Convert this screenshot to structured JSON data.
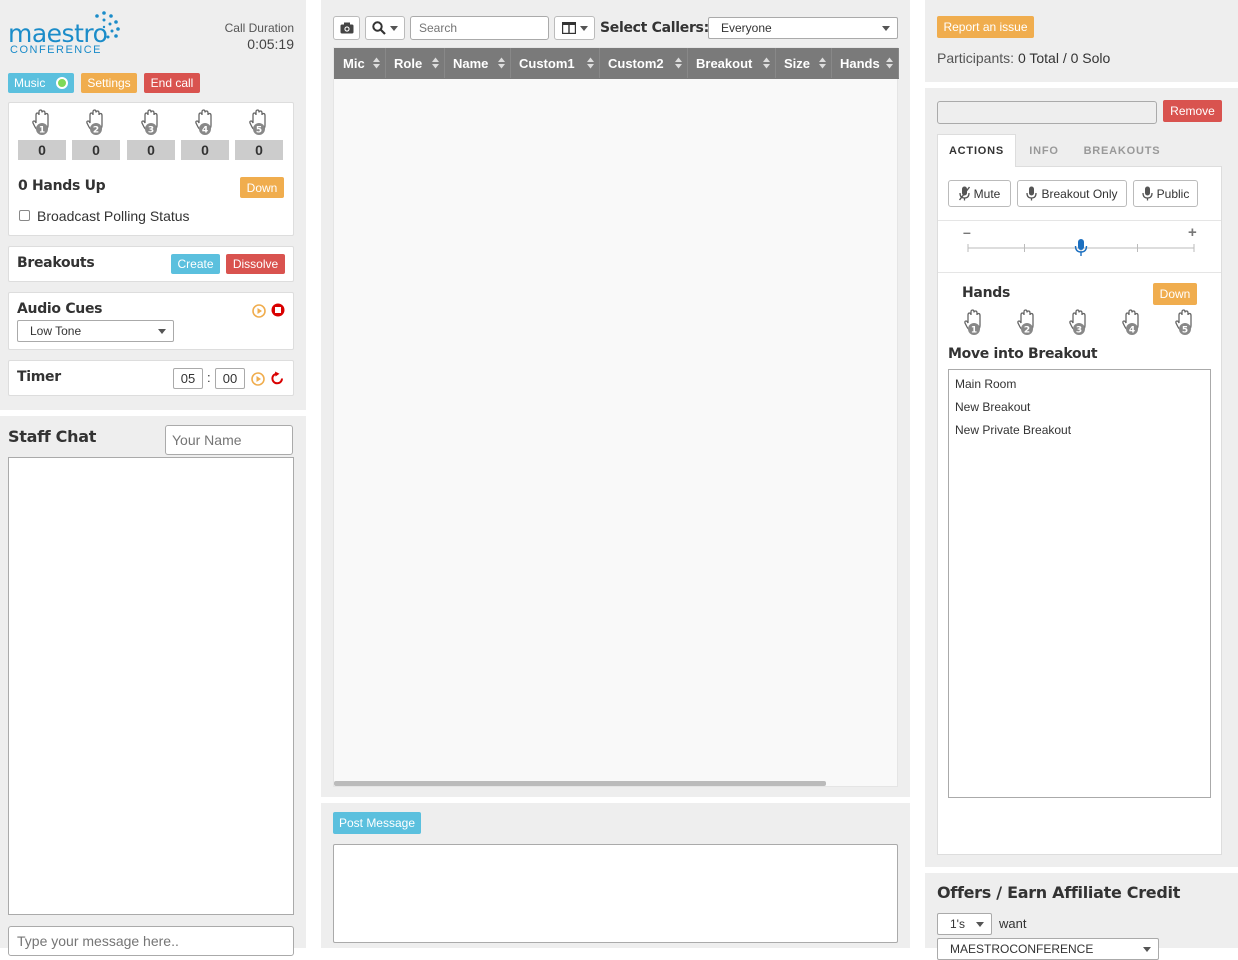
{
  "logo": {
    "word1": "maestro",
    "word2": "CONFERENCE"
  },
  "call": {
    "label": "Call Duration",
    "value": "0:05:19"
  },
  "controls": {
    "music": "Music",
    "settings": "Settings",
    "end_call": "End call"
  },
  "hands_panel": {
    "counts": [
      "0",
      "0",
      "0",
      "0",
      "0"
    ],
    "hand_numbers": [
      "1",
      "2",
      "3",
      "4",
      "5"
    ],
    "hands_up": "0 Hands Up",
    "down": "Down",
    "broadcast": "Broadcast Polling Status"
  },
  "breakouts": {
    "title": "Breakouts",
    "create": "Create",
    "dissolve": "Dissolve"
  },
  "audio_cues": {
    "title": "Audio Cues",
    "selected": "Low Tone"
  },
  "timer": {
    "title": "Timer",
    "minutes": "05",
    "seconds": "00",
    "separator": ":"
  },
  "staff_chat": {
    "title": "Staff Chat",
    "name_placeholder": "Your Name",
    "message_placeholder": "Type your message here.."
  },
  "toolbar": {
    "search_placeholder": "Search",
    "select_callers_label": "Select Callers:",
    "select_callers_value": "Everyone"
  },
  "table": {
    "columns": [
      "Mic",
      "Role",
      "Name",
      "Custom1",
      "Custom2",
      "Breakout",
      "Size",
      "Hands"
    ]
  },
  "post": {
    "button": "Post Message"
  },
  "right": {
    "report": "Report an issue",
    "participants_label": "Participants:",
    "participants_value": "0 Total / 0 Solo",
    "remove": "Remove",
    "tabs": [
      "ACTIONS",
      "INFO",
      "BREAKOUTS"
    ],
    "actions": {
      "mute": "Mute",
      "breakout_only": "Breakout Only",
      "public": "Public"
    },
    "slider": {
      "minus": "–",
      "plus": "+",
      "level": 0.5
    },
    "hands_title": "Hands",
    "hands_down": "Down",
    "move_title": "Move into Breakout",
    "breakout_list": [
      "Main Room",
      "New Breakout",
      "New Private Breakout"
    ],
    "offers_title": "Offers / Earn Affiliate Credit",
    "offers_select": "1's",
    "offers_want": "want",
    "offers_select2": "MAESTROCONFERENCE"
  },
  "colors": {
    "blue": "#5bc0de",
    "orange": "#f0ad4e",
    "red": "#d9534f",
    "header": "#7a7a7a",
    "brand": "#1b8cc9"
  }
}
